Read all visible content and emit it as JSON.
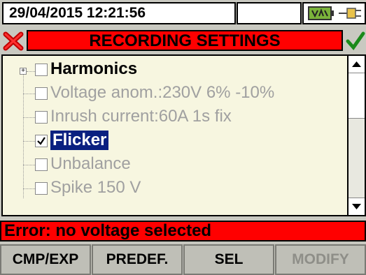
{
  "status": {
    "datetime": "29/04/2015 12:21:56"
  },
  "header": {
    "title": "RECORDING SETTINGS"
  },
  "list": {
    "items": [
      {
        "label": "Harmonics",
        "state": "enabled",
        "checked": false
      },
      {
        "label": "Voltage anom.:230V 6% -10%",
        "state": "disabled",
        "checked": false
      },
      {
        "label": "Inrush current:60A 1s fix",
        "state": "disabled",
        "checked": false
      },
      {
        "label": "Flicker",
        "state": "selected",
        "checked": true
      },
      {
        "label": "Unbalance",
        "state": "disabled",
        "checked": false
      },
      {
        "label": "Spike 150 V",
        "state": "disabled",
        "checked": false
      }
    ]
  },
  "error": {
    "message": "Error: no voltage selected"
  },
  "buttons": {
    "b1": "CMP/EXP",
    "b2": "PREDEF.",
    "b3": "SEL",
    "b4": "MODIFY"
  },
  "colors": {
    "title_bg": "#ff0000",
    "error_bg": "#ff0000",
    "selection_bg": "#0a2080",
    "list_bg": "#f7f6e0"
  }
}
